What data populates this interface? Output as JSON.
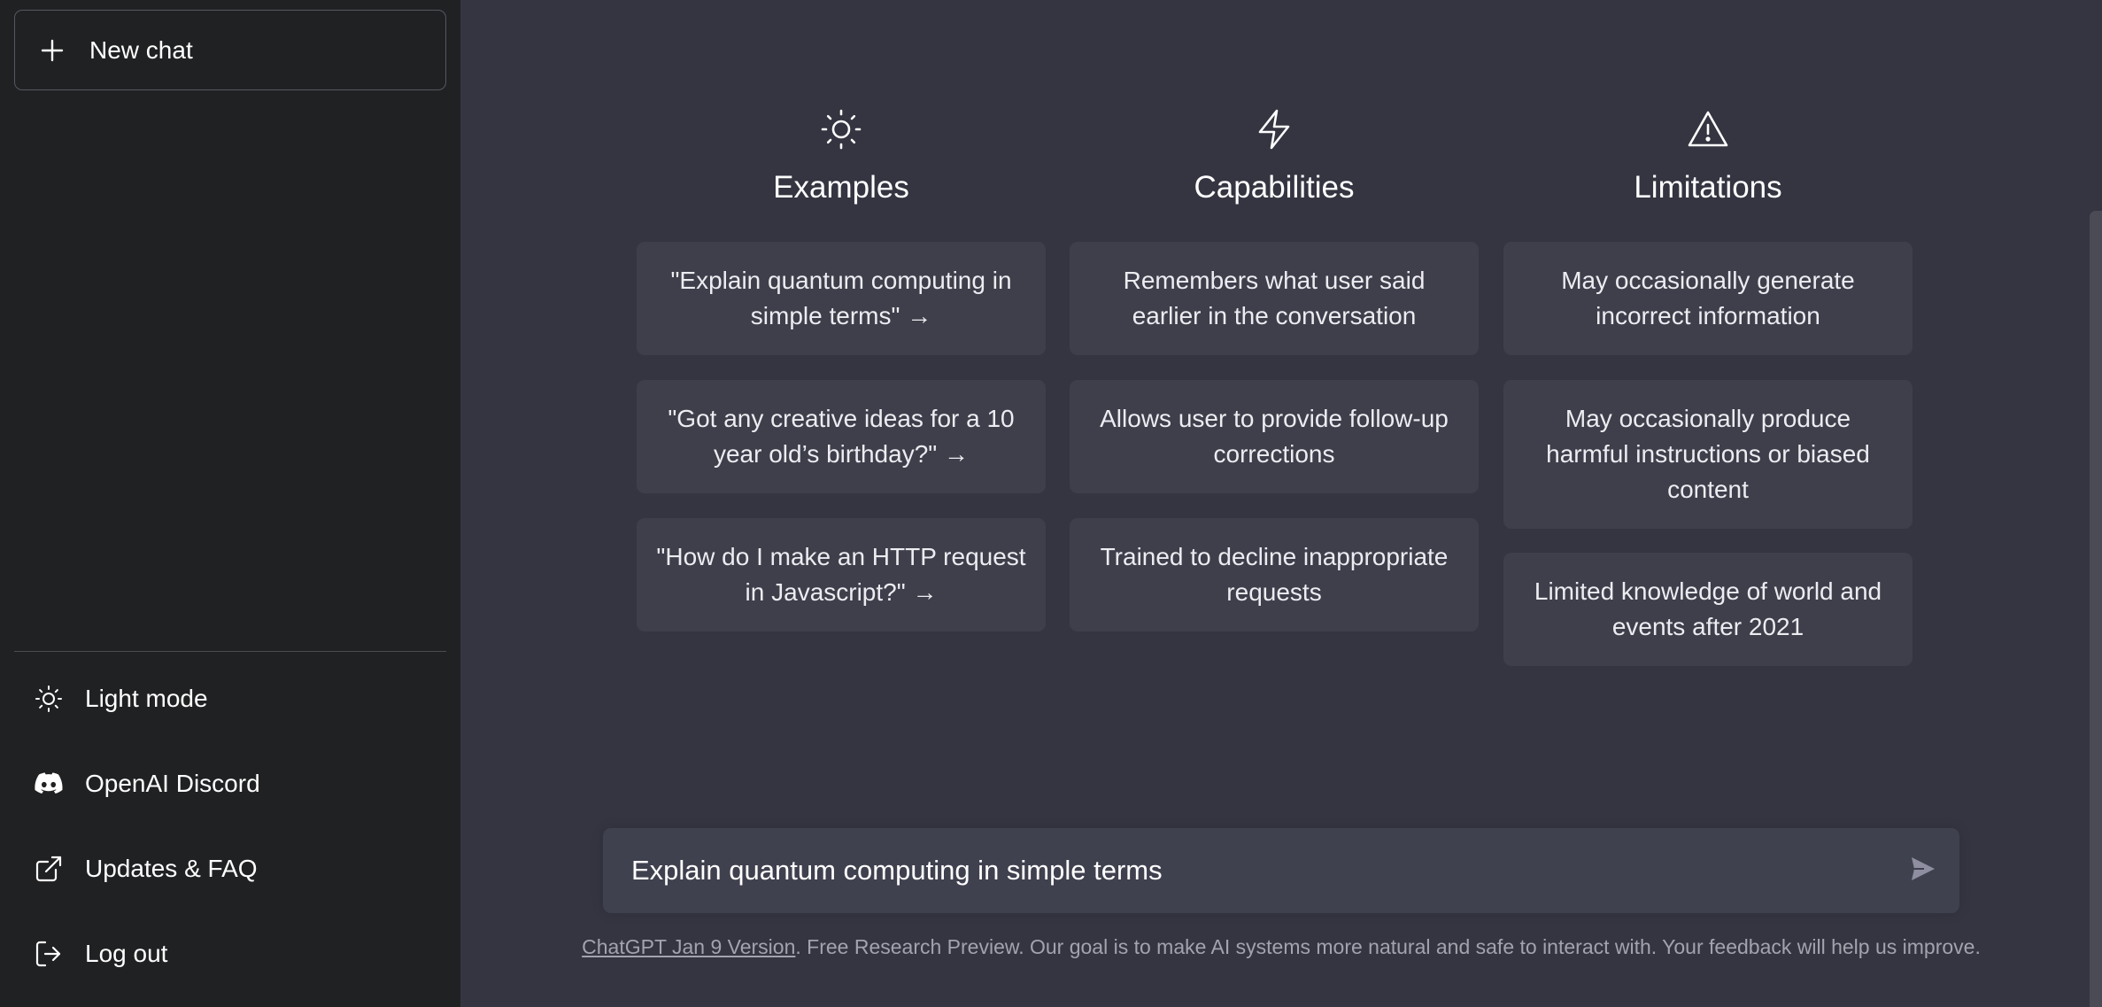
{
  "sidebar": {
    "new_chat_label": "New chat",
    "bottom_items": [
      {
        "label": "Light mode",
        "icon": "sun-icon"
      },
      {
        "label": "OpenAI Discord",
        "icon": "discord-icon"
      },
      {
        "label": "Updates & FAQ",
        "icon": "external-link-icon"
      },
      {
        "label": "Log out",
        "icon": "logout-icon"
      }
    ]
  },
  "columns": [
    {
      "title": "Examples",
      "icon": "sun-icon",
      "cards": [
        "\"Explain quantum computing in simple terms\" →",
        "\"Got any creative ideas for a 10 year old’s birthday?\" →",
        "\"How do I make an HTTP request in Javascript?\" →"
      ]
    },
    {
      "title": "Capabilities",
      "icon": "lightning-icon",
      "cards": [
        "Remembers what user said earlier in the conversation",
        "Allows user to provide follow-up corrections",
        "Trained to decline inappropriate requests"
      ]
    },
    {
      "title": "Limitations",
      "icon": "warning-icon",
      "cards": [
        "May occasionally generate incorrect information",
        "May occasionally produce harmful instructions or biased content",
        "Limited knowledge of world and events after 2021"
      ]
    }
  ],
  "composer": {
    "value": "Explain quantum computing in simple terms"
  },
  "footer": {
    "link_text": "ChatGPT Jan 9 Version",
    "text": ". Free Research Preview. Our goal is to make AI systems more natural and safe to interact with. Your feedback will help us improve."
  },
  "colors": {
    "sidebar_bg": "#202123",
    "main_bg": "#343541",
    "card_bg": "#3e3f4b",
    "input_bg": "#40414f"
  }
}
